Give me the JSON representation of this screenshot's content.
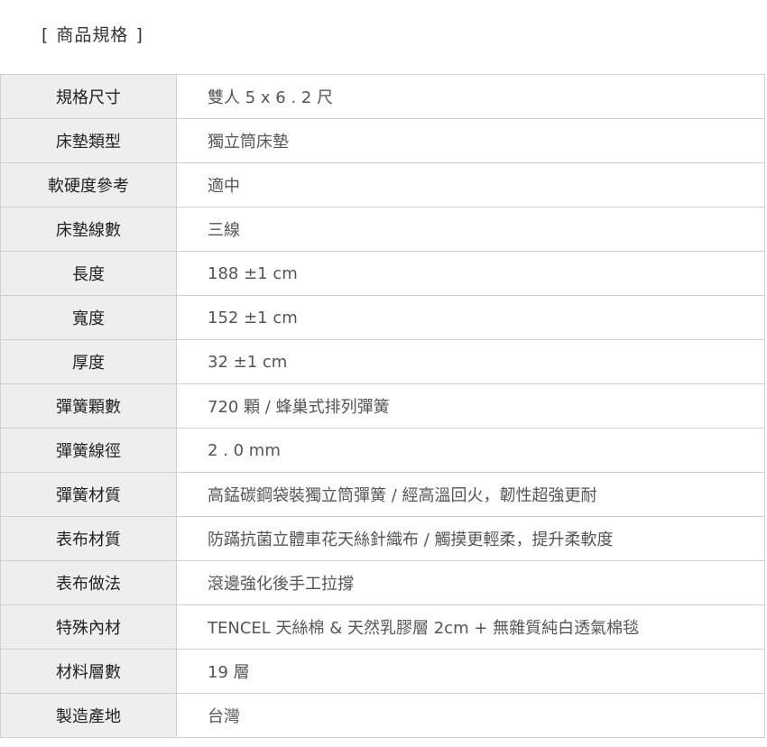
{
  "section": {
    "bracket_open": "[",
    "title": "商品規格",
    "bracket_close": "]"
  },
  "specs": [
    {
      "label": "規格尺寸",
      "value": "雙人 5 x 6 . 2 尺"
    },
    {
      "label": "床墊類型",
      "value": "獨立筒床墊"
    },
    {
      "label": "軟硬度參考",
      "value": "適中"
    },
    {
      "label": "床墊線數",
      "value": "三線"
    },
    {
      "label": "長度",
      "value": "188 ±1 cm"
    },
    {
      "label": "寬度",
      "value": "152 ±1 cm"
    },
    {
      "label": "厚度",
      "value": "32 ±1 cm"
    },
    {
      "label": "彈簧顆數",
      "value": "720 顆 / 蜂巢式排列彈簧"
    },
    {
      "label": "彈簧線徑",
      "value": "2 . 0 mm"
    },
    {
      "label": "彈簧材質",
      "value": "高錳碳鋼袋裝獨立筒彈簧 / 經高溫回火，韌性超強更耐"
    },
    {
      "label": "表布材質",
      "value": "防蹣抗菌立體車花天絲針織布 / 觸摸更輕柔，提升柔軟度"
    },
    {
      "label": "表布做法",
      "value": "滾邊強化後手工拉撐"
    },
    {
      "label": "特殊內材",
      "value": "TENCEL 天絲棉 & 天然乳膠層 2cm + 無雜質純白透氣棉毯"
    },
    {
      "label": "材料層數",
      "value": "19 層"
    },
    {
      "label": "製造產地",
      "value": "台灣"
    }
  ]
}
